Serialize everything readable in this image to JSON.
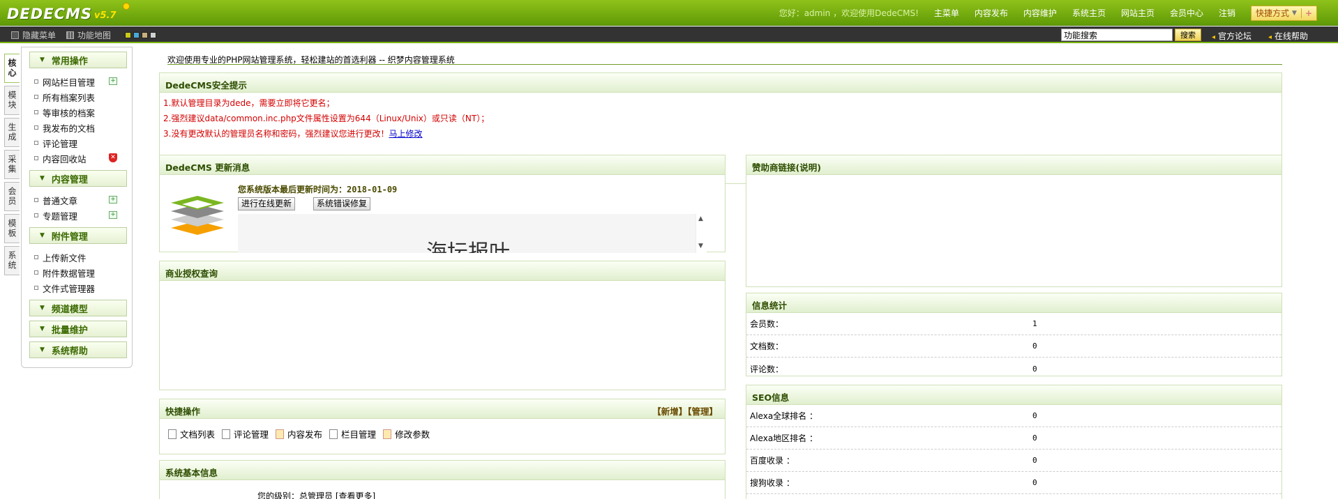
{
  "header": {
    "logo_text": "DEDECMS",
    "logo_version": "v5.7",
    "welcome": "您好：admin ，欢迎使用DedeCMS!",
    "nav": [
      "主菜单",
      "内容发布",
      "内容维护",
      "系统主页",
      "网站主页",
      "会员中心",
      "注销"
    ],
    "quick_menu_label": "快捷方式",
    "quick_menu_plus": "+"
  },
  "toolbar": {
    "hide_menu": "隐藏菜单",
    "function_map": "功能地图",
    "skin_colors": [
      "#c9c91a",
      "#4aa7d6",
      "#c8b07a",
      "#d0d0d0"
    ],
    "search_value": "功能搜索",
    "search_button": "搜索",
    "forum": "官方论坛",
    "online_help": "在线帮助"
  },
  "vtabs": [
    {
      "label": "核心",
      "active": true
    },
    {
      "label": "模块",
      "active": false
    },
    {
      "label": "生成",
      "active": false
    },
    {
      "label": "采集",
      "active": false
    },
    {
      "label": "会员",
      "active": false
    },
    {
      "label": "模板",
      "active": false
    },
    {
      "label": "系统",
      "active": false
    }
  ],
  "menu": {
    "groups": [
      {
        "title": "常用操作",
        "items": [
          "网站栏目管理",
          "所有档案列表",
          "等审核的档案",
          "我发布的文档",
          "评论管理",
          "内容回收站"
        ]
      },
      {
        "title": "内容管理",
        "items": [
          "普通文章",
          "专题管理"
        ]
      },
      {
        "title": "附件管理",
        "items": [
          "上传新文件",
          "附件数据管理",
          "文件式管理器"
        ]
      },
      {
        "title": "频道模型",
        "items": []
      },
      {
        "title": "批量维护",
        "items": []
      },
      {
        "title": "系统帮助",
        "items": []
      }
    ]
  },
  "main": {
    "intro": "欢迎使用专业的PHP网站管理系统，轻松建站的首选利器 -- 织梦内容管理系统",
    "security": {
      "title": "DedeCMS安全提示",
      "lines": [
        "1.默认管理目录为dede，需要立即将它更名；",
        "2.强烈建议data/common.inc.php文件属性设置为644（Linux/Unix）或只读（NT）；",
        "3.没有更改默认的管理员名称和密码，强烈建议您进行更改！"
      ],
      "fix_link": "马上修改"
    },
    "update": {
      "title": "DedeCMS 更新消息",
      "last_update_label": "您系统版本最后更新时间为：",
      "last_update_date": "2018-01-09",
      "online_update_button": "进行在线更新",
      "repair_button": "系统错误修复",
      "news_preview": "海坛报叶"
    },
    "sponsor": {
      "title": "赞助商链接",
      "note": "(说明)"
    },
    "license": {
      "title": "商业授权查询"
    },
    "stats": {
      "title": "信息统计",
      "rows": [
        {
          "label": "会员数：",
          "value": "1"
        },
        {
          "label": "文档数：",
          "value": "0"
        },
        {
          "label": "评论数：",
          "value": "0"
        }
      ]
    },
    "quick_ops": {
      "title": "快捷操作",
      "links": "【新增】【管理】",
      "items": [
        "文档列表",
        "评论管理",
        "内容发布",
        "栏目管理",
        "修改参数"
      ]
    },
    "seo": {
      "title": "SEO信息",
      "rows": [
        {
          "label": "Alexa全球排名 ：",
          "value": "0"
        },
        {
          "label": "Alexa地区排名 ：",
          "value": "0"
        },
        {
          "label": "百度收录 ：",
          "value": "0"
        },
        {
          "label": "搜狗收录 ：",
          "value": "0"
        }
      ]
    },
    "sysinfo": {
      "title": "系统基本信息",
      "level_label": "您的级别：",
      "level_value": "总管理员 [查看更多]"
    }
  }
}
